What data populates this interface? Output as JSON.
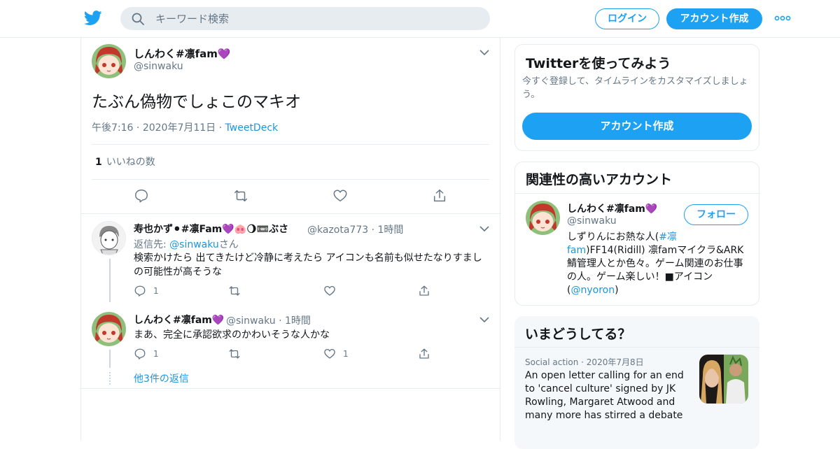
{
  "search": {
    "placeholder": "キーワード検索"
  },
  "header": {
    "login_label": "ログイン",
    "signup_label": "アカウント作成"
  },
  "colors": {
    "accent": "#1da1f2",
    "link": "#1b95e0",
    "muted": "#657786",
    "heart_badge": "#9b59d0"
  },
  "tweet": {
    "name": "しんわく#凛fam",
    "badge": "💜",
    "handle": "@sinwaku",
    "text": "たぶん偽物でしょこのマキオ",
    "time": "午後7:16",
    "date": "2020年7月11日",
    "source": "TweetDeck",
    "likes_count": "1",
    "likes_label": "いいねの数"
  },
  "replies": [
    {
      "name": "寿也かず⚫#凛Fam💜🐽🌖📼ぶさ",
      "handle": "@kazota773",
      "time": "1時間",
      "reply_to_prefix": "返信先: ",
      "reply_to_handle": "@sinwaku",
      "reply_to_suffix": "さん",
      "text": "検索かけたら 出てきたけど冷静に考えたら アイコンも名前も似せたなりすましの可能性が高そうな",
      "reply_count": "1",
      "like_count": ""
    },
    {
      "name": "しんわく#凛fam💜",
      "handle": "@sinwaku",
      "time": "1時間",
      "text": "まあ、完全に承認欲求のかわいそうな人かな",
      "reply_count": "1",
      "like_count": "1"
    }
  ],
  "more_replies": "他3件の返信",
  "sidebar": {
    "signup_card": {
      "title": "Twitterを使ってみよう",
      "subtitle": "今すぐ登録して、タイムラインをカスタマイズしましょう。",
      "button": "アカウント作成"
    },
    "related": {
      "title": "関連性の高いアカウント",
      "name": "しんわく#凛fam",
      "badge": "💜",
      "handle": "@sinwaku",
      "follow": "フォロー",
      "bio_1": "しずりんにお熱な人(",
      "bio_link": "#凛fam",
      "bio_2": ")FF14(Ridill) 凛famマイクラ&ARK鯖管理人とか色々。ゲーム関連のお仕事の人。ゲーム楽しい！■アイコン(",
      "bio_mention": "@nyoron",
      "bio_3": ")"
    },
    "trends": {
      "title": "いまどうしてる？",
      "category": "Social action",
      "date": "2020年7月8日",
      "headline": "An open letter calling for an end to 'cancel culture' signed by JK Rowling, Margaret Atwood and many more has stirred a debate"
    }
  }
}
